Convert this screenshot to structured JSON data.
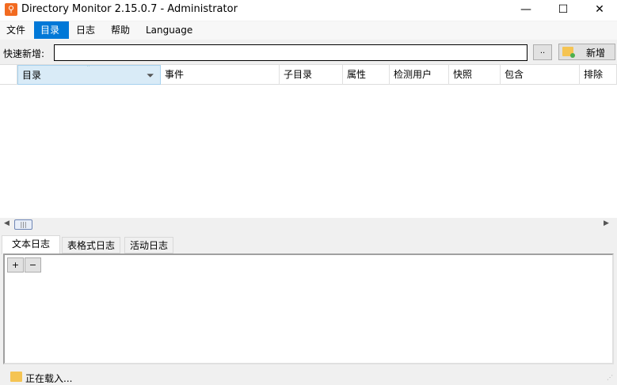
{
  "window": {
    "title": "Directory Monitor 2.15.0.7 - Administrator",
    "controls": {
      "minimize": "—",
      "maximize": "☐",
      "close": "✕"
    }
  },
  "menu": [
    {
      "label": "文件"
    },
    {
      "label": "目录",
      "selected": true
    },
    {
      "label": "日志"
    },
    {
      "label": "帮助"
    },
    {
      "label": "Language"
    }
  ],
  "quick_add": {
    "label": "快速新增:",
    "value": "",
    "browse_label": "..",
    "add_label": "新增"
  },
  "grid": {
    "columns": [
      "目录",
      "事件",
      "子目录",
      "属性",
      "检测用户",
      "快照",
      "包含",
      "排除"
    ],
    "sort_indicator": "˄",
    "rows": []
  },
  "log_tabs": [
    {
      "label": "文本日志",
      "selected": true
    },
    {
      "label": "表格式日志"
    },
    {
      "label": "活动日志"
    }
  ],
  "log_toolbar": {
    "expand": "+",
    "collapse": "−"
  },
  "status": {
    "text": "正在载入..."
  }
}
